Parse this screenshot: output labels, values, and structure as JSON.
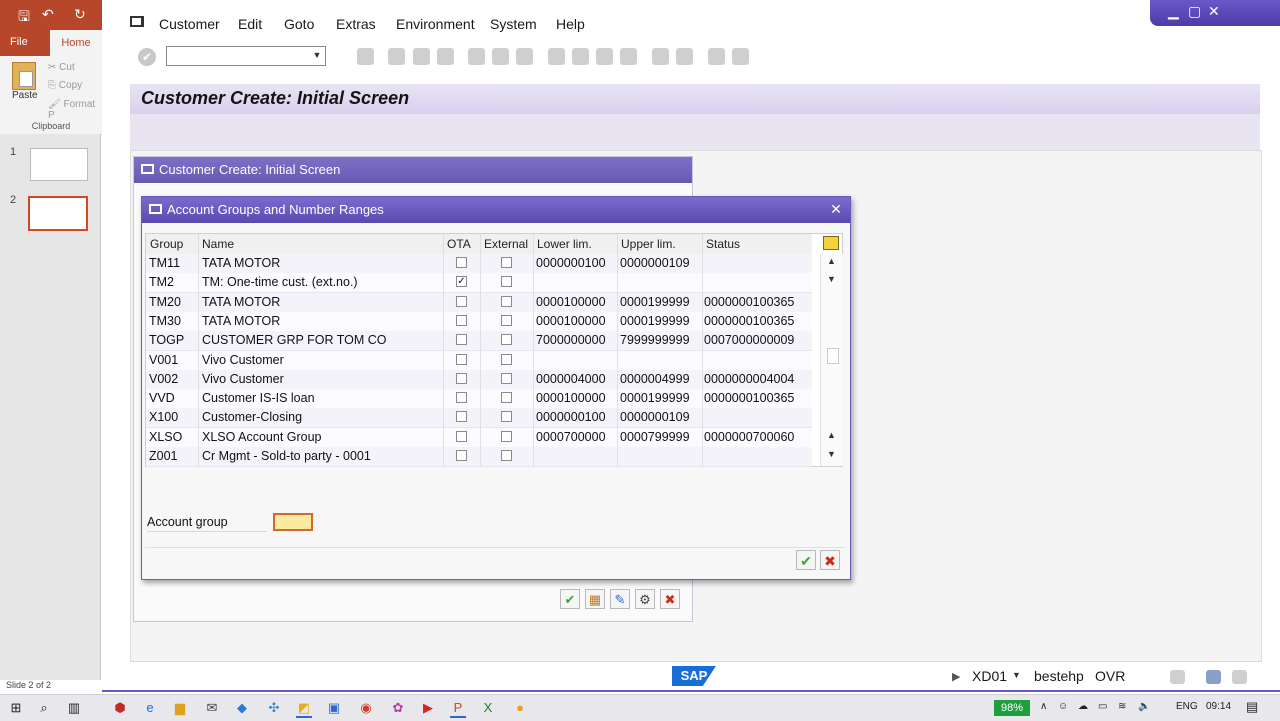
{
  "ppt": {
    "tab_file": "File",
    "tab_home": "Home",
    "paste": "Paste",
    "cut": "Cut",
    "copy": "Copy",
    "format_painter": "Format P",
    "clipboard": "Clipboard",
    "slides": [
      "1",
      "2"
    ],
    "status": "Slide 2 of 2"
  },
  "sap": {
    "menu": [
      "Customer",
      "Edit",
      "Goto",
      "Extras",
      "Environment",
      "System",
      "Help"
    ],
    "screen_title": "Customer Create: Initial Screen",
    "popup1_title": "Customer Create: Initial Screen",
    "dialog": {
      "title": "Account Groups and Number Ranges",
      "columns": [
        "Group",
        "Name",
        "OTA",
        "External",
        "Lower lim.",
        "Upper lim.",
        "Status"
      ],
      "rows": [
        {
          "group": "TM11",
          "name": "TATA MOTOR",
          "ota": "",
          "external": "",
          "lower": "0000000100",
          "upper": "0000000109",
          "status": ""
        },
        {
          "group": "TM2",
          "name": "TM: One-time cust. (ext.no.)",
          "ota": "✓",
          "external": "",
          "lower": "",
          "upper": "",
          "status": ""
        },
        {
          "group": "TM20",
          "name": "TATA MOTOR",
          "ota": "",
          "external": "",
          "lower": "0000100000",
          "upper": "0000199999",
          "status": "0000000100365"
        },
        {
          "group": "TM30",
          "name": "TATA MOTOR",
          "ota": "",
          "external": "",
          "lower": "0000100000",
          "upper": "0000199999",
          "status": "0000000100365"
        },
        {
          "group": "TOGP",
          "name": "CUSTOMER GRP FOR TOM CO",
          "ota": "",
          "external": "",
          "lower": "7000000000",
          "upper": "7999999999",
          "status": "0007000000009"
        },
        {
          "group": "V001",
          "name": "Vivo Customer",
          "ota": "",
          "external": "",
          "lower": "",
          "upper": "",
          "status": ""
        },
        {
          "group": "V002",
          "name": "Vivo Customer",
          "ota": "",
          "external": "",
          "lower": "0000004000",
          "upper": "0000004999",
          "status": "0000000004004"
        },
        {
          "group": "VVD",
          "name": "Customer IS-IS loan",
          "ota": "",
          "external": "",
          "lower": "0000100000",
          "upper": "0000199999",
          "status": "0000000100365"
        },
        {
          "group": "X100",
          "name": "Customer-Closing",
          "ota": "",
          "external": "",
          "lower": "0000000100",
          "upper": "0000000109",
          "status": ""
        },
        {
          "group": "XLSO",
          "name": "XLSO Account Group",
          "ota": "",
          "external": "",
          "lower": "0000700000",
          "upper": "0000799999",
          "status": "0000000700060"
        },
        {
          "group": "Z001",
          "name": "Cr Mgmt - Sold-to party - 0001",
          "ota": "",
          "external": "",
          "lower": "",
          "upper": "",
          "status": ""
        }
      ],
      "account_group_label": "Account group",
      "account_group_value": ""
    },
    "status": {
      "system": "XD01",
      "user": "bestehp",
      "mode": "OVR"
    }
  },
  "taskbar": {
    "battery": "98%",
    "lang": "ENG",
    "time": "09:14"
  }
}
